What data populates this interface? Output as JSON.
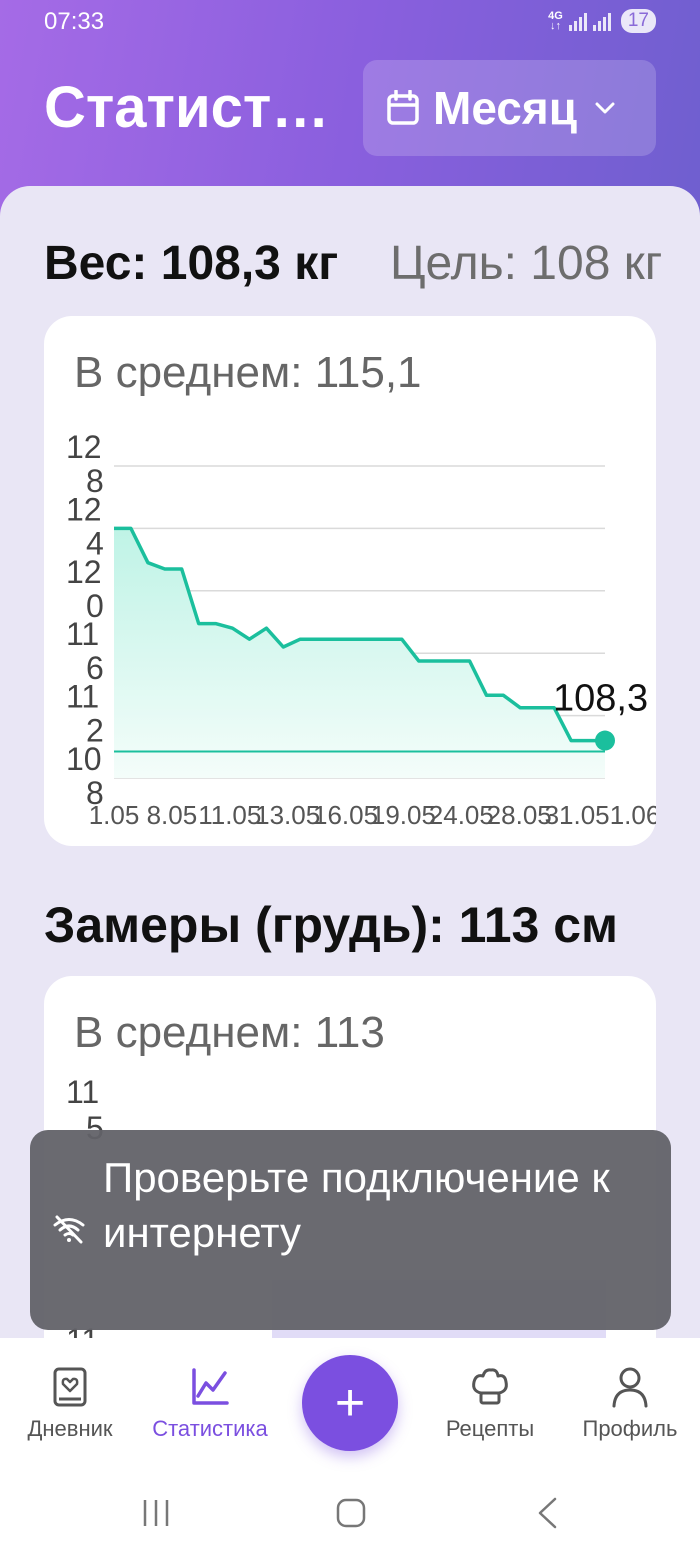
{
  "status_bar": {
    "time": "07:33",
    "network": "4G",
    "battery": "17"
  },
  "header": {
    "title": "Статистика",
    "period_label": "Месяц",
    "accent": "#8a5fde"
  },
  "weight": {
    "title": "Вес: 108,3 кг",
    "goal": "Цель: 108 кг",
    "average": "В среднем: 115,1"
  },
  "chart_data": {
    "type": "area",
    "y_tick_labels": [
      "12\n8",
      "12\n4",
      "12\n0",
      "11\n6",
      "11\n2",
      "10\n8"
    ],
    "x_tick_labels": [
      "1.05",
      "8.05",
      "11.05",
      "13.05",
      "16.05",
      "19.05",
      "24.05",
      "28.05",
      "31.05",
      "1.06"
    ],
    "ylim": [
      108,
      128
    ],
    "goal_line": 108,
    "last_label": "108,3",
    "values": [
      124,
      124,
      121.8,
      121.4,
      121.4,
      117.9,
      117.9,
      117.6,
      116.9,
      117.6,
      116.4,
      116.9,
      116.9,
      116.9,
      116.9,
      116.9,
      116.9,
      116.9,
      115.5,
      115.5,
      115.5,
      115.5,
      113.3,
      113.3,
      112.5,
      112.5,
      112.5,
      110.4,
      110.4,
      110.4
    ],
    "line_color": "#1bbf9d"
  },
  "chest": {
    "title": "Замеры (грудь): 113 см",
    "average": "В среднем: 113",
    "y_top_label": "11",
    "y_top_label2": "5",
    "y_bottom_label": "11"
  },
  "toast": {
    "text": "Проверьте подключение к интернету"
  },
  "nav": {
    "items": [
      {
        "label": "Дневник"
      },
      {
        "label": "Статистика"
      },
      {
        "label": "Рецепты"
      },
      {
        "label": "Профиль"
      }
    ],
    "fab_label": "+"
  }
}
